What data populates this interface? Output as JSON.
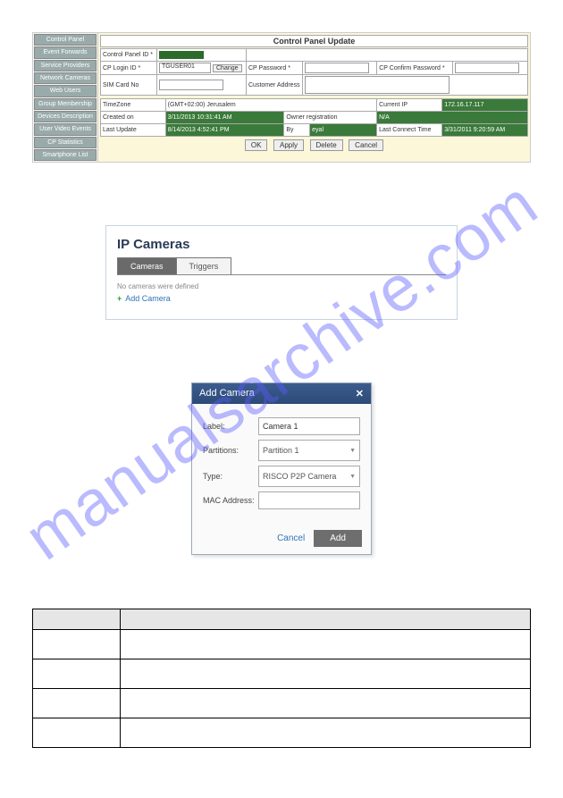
{
  "watermark": "manualsarchive.com",
  "sidebar": {
    "items": [
      {
        "label": "Control Panel"
      },
      {
        "label": "Event Forwards"
      },
      {
        "label": "Service Providers"
      },
      {
        "label": "Network Cameras"
      },
      {
        "label": "Web Users"
      },
      {
        "label": "Group Membership"
      },
      {
        "label": "Devices Description"
      },
      {
        "label": "User Video Events"
      },
      {
        "label": "CP Statistics"
      },
      {
        "label": "Smartphone List"
      }
    ]
  },
  "cp": {
    "title": "Control Panel Update",
    "rows": {
      "control_panel_id": "Control Panel ID *",
      "cp_login_id": "CP Login ID *",
      "cp_login_val": "TGUSER01",
      "change": "Change",
      "cp_password": "CP Password *",
      "cp_confirm_password": "CP Confirm Password *",
      "sim_card_no": "SIM Card No",
      "customer_address": "Customer Address",
      "timezone": "TimeZone",
      "timezone_val": "(GMT+02:00) Jerusalem",
      "current_ip": "Current IP",
      "current_ip_val": "172.16.17.117",
      "created_on": "Created on",
      "created_on_val": "3/11/2013 10:31:41 AM",
      "owner_reg": "Owner registration",
      "owner_reg_val": "N/A",
      "last_update": "Last Update",
      "last_update_val": "8/14/2013 4:52:41 PM",
      "by": "By",
      "by_val": "eyal",
      "last_connect": "Last Connect Time",
      "last_connect_val": "3/31/2011 9:20:59 AM"
    },
    "buttons": {
      "ok": "OK",
      "apply": "Apply",
      "delete": "Delete",
      "cancel": "Cancel"
    }
  },
  "ipcam": {
    "title": "IP Cameras",
    "tab_cameras": "Cameras",
    "tab_triggers": "Triggers",
    "no_cameras": "No cameras were defined",
    "add_camera": "Add Camera"
  },
  "dialog": {
    "title": "Add Camera",
    "label_lbl": "Label:",
    "label_val": "Camera 1",
    "partitions_lbl": "Partitions:",
    "partitions_val": "Partition 1",
    "type_lbl": "Type:",
    "type_val": "RISCO P2P Camera",
    "mac_lbl": "MAC Address:",
    "mac_val": "",
    "cancel": "Cancel",
    "add": "Add"
  }
}
